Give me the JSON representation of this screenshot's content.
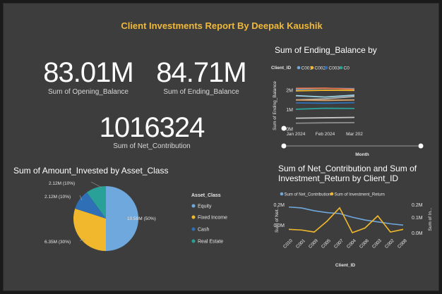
{
  "report": {
    "title": "Client Investments Report By Deepak Kaushik"
  },
  "cards": [
    {
      "value": "83.01M",
      "label": "Sum of Opening_Balance"
    },
    {
      "value": "84.71M",
      "label": "Sum of Ending_Balance"
    },
    {
      "value": "1016324",
      "label": "Sum of Net_Contribution"
    }
  ],
  "colors": {
    "c001": "#6fa8dc",
    "c002": "#f1b82d",
    "c003": "#2f6fb5",
    "c004": "#2aa198",
    "background": "#3d3d3d",
    "title": "#f0b93a"
  },
  "chart_data": [
    {
      "type": "line",
      "title": "Sum of Ending_Balance by",
      "legend_title": "Client_ID",
      "legend": [
        "C001",
        "C002",
        "C003",
        "C0"
      ],
      "xlabel": "Month",
      "ylabel": "Sum of Ending_Balance",
      "x": [
        "Jan 2024",
        "Feb 2024",
        "Mar 202"
      ],
      "yticks": [
        "2M",
        "1M",
        "0M"
      ],
      "ylim": [
        0,
        2400000
      ],
      "series": [
        {
          "name": "C001",
          "color": "#6fa8dc",
          "values": [
            2050000,
            2100000,
            2080000
          ]
        },
        {
          "name": "C002",
          "color": "#f1b82d",
          "values": [
            1970000,
            2000000,
            1990000
          ]
        },
        {
          "name": "",
          "color": "#e8744a",
          "values": [
            2100000,
            2110000,
            2050000
          ]
        },
        {
          "name": "",
          "color": "#b0b0b0",
          "values": [
            1500000,
            1560000,
            1680000
          ]
        },
        {
          "name": "",
          "color": "#9ad0e0",
          "values": [
            1720000,
            1650000,
            1750000
          ]
        },
        {
          "name": "",
          "color": "#d9a46b",
          "values": [
            1500000,
            1480000,
            1500000
          ]
        },
        {
          "name": "C003",
          "color": "#2f6fb5",
          "values": [
            1350000,
            1330000,
            1360000
          ]
        },
        {
          "name": "C0",
          "color": "#2aa198",
          "values": [
            1020000,
            1070000,
            1060000
          ]
        },
        {
          "name": "",
          "color": "#c8c8c8",
          "values": [
            560000,
            580000,
            600000
          ]
        },
        {
          "name": "",
          "color": "#8a8a8a",
          "values": [
            300000,
            320000,
            330000
          ]
        }
      ]
    },
    {
      "type": "pie",
      "title": "Sum of Amount_Invested by Asset_Class",
      "legend_title": "Asset_Class",
      "slices": [
        {
          "name": "Equity",
          "value": 10.59,
          "label": "10.59M (50%)",
          "color": "#6fa8dc"
        },
        {
          "name": "Fixed Income",
          "value": 6.35,
          "label": "6.35M (30%)",
          "color": "#f1b82d"
        },
        {
          "name": "Cash",
          "value": 2.12,
          "label": "2.12M (10%)",
          "color": "#2f6fb5"
        },
        {
          "name": "Real Estate",
          "value": 2.12,
          "label": "2.12M (10%)",
          "color": "#2aa198"
        }
      ]
    },
    {
      "type": "line",
      "title": "Sum of Net_Contribution and Sum of Investment_Return by Client_ID",
      "title_lines": [
        "Sum of Net_Contribution and Sum of",
        "Investment_Return by Client_ID"
      ],
      "xlabel": "Client_ID",
      "ylabel_left": "Sum of Net...",
      "ylabel_right": "Sum of In...",
      "categories": [
        "C010",
        "C001",
        "C009",
        "C005",
        "C007",
        "C004",
        "C006",
        "C003",
        "C002",
        "C008"
      ],
      "left_ticks": [
        "0.2M",
        "0.0M"
      ],
      "right_ticks": [
        "0.2M",
        "0.1M",
        "0.0M"
      ],
      "series": [
        {
          "name": "Sum of Net_Contribution",
          "color": "#6fa8dc",
          "axis": "left",
          "values": [
            200000,
            190000,
            160000,
            140000,
            130000,
            90000,
            60000,
            40000,
            20000,
            5000
          ]
        },
        {
          "name": "Sum of Investment_Return",
          "color": "#f1b82d",
          "axis": "right",
          "values": [
            30000,
            25000,
            10000,
            90000,
            190000,
            5000,
            40000,
            130000,
            10000,
            30000
          ]
        }
      ]
    }
  ]
}
